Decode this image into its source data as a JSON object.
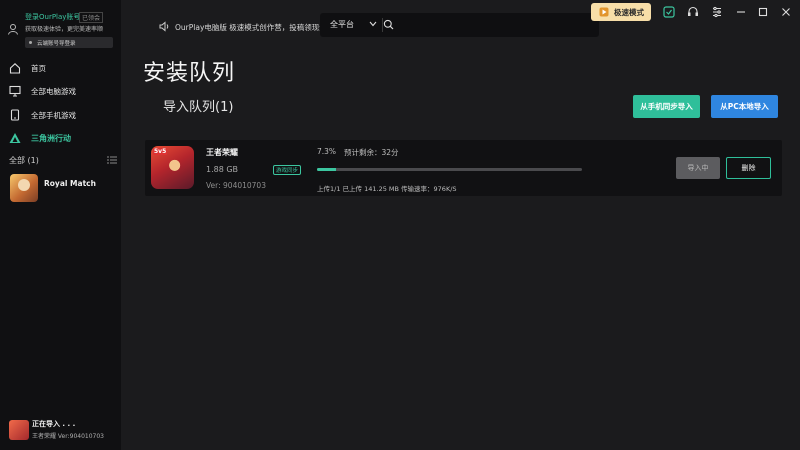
{
  "account": {
    "login_label": "登录OurPlay账号",
    "status": "已领会",
    "promo": "获取极速体验，更完美速率顺",
    "cloud": "云端账号导登录"
  },
  "sidebar": {
    "items": [
      {
        "label": "首页",
        "icon": "home-icon"
      },
      {
        "label": "全部电脑游戏",
        "icon": "monitor-icon"
      },
      {
        "label": "全部手机游戏",
        "icon": "phone-icon"
      },
      {
        "label": "三角洲行动",
        "icon": "delta-icon",
        "active": true
      }
    ],
    "all_label": "全部 (1)",
    "games": [
      {
        "name": "Royal Match"
      }
    ],
    "importing": {
      "title": "正在导入 . . .",
      "subtitle": "王者荣耀 Ver:904010703"
    }
  },
  "topbar": {
    "notice": "OurPlay电脑版 极速模式创作营，投稿领现金，着",
    "platform": "全平台",
    "speed_mode": "极速模式",
    "accent": "#3cc6a0"
  },
  "main": {
    "page_title": "安装队列",
    "queue_title": "导入队列(1)",
    "btn_phone": "从手机同步导入",
    "btn_pc": "从PC本地导入",
    "card": {
      "name": "王者荣耀",
      "badge": "5v5",
      "size": "1.88 GB",
      "sync_tag": "游戏同步",
      "version": "Ver: 904010703",
      "percent_text": "7.3%",
      "progress": 0.073,
      "remaining": "预计剩余：32分",
      "upload_info": "上传1/1 已上传 141.25 MB   传输速率：976K/S",
      "btn_import": "导入中",
      "btn_delete": "删除"
    }
  }
}
